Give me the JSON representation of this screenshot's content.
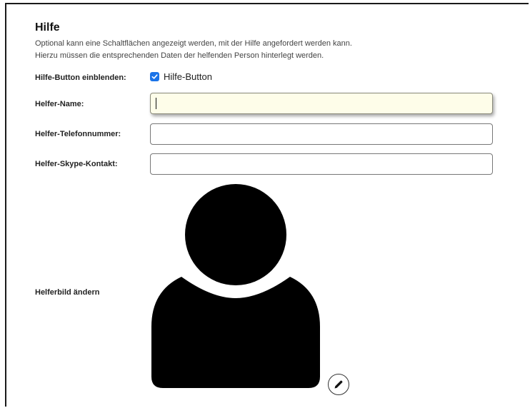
{
  "section": {
    "title": "Hilfe",
    "description_line1": "Optional kann eine Schaltflächen angezeigt werden, mit der Hilfe angefordert werden kann.",
    "description_line2": "Hierzu müssen die entsprechenden Daten der helfenden Person hinterlegt werden."
  },
  "form": {
    "help_button": {
      "label": "Hilfe-Button einblenden:",
      "checkbox_label": "Hilfe-Button",
      "checked": true
    },
    "helper_name": {
      "label": "Helfer-Name:",
      "value": ""
    },
    "helper_phone": {
      "label": "Helfer-Telefonnummer:",
      "value": ""
    },
    "helper_skype": {
      "label": "Helfer-Skype-Kontakt:",
      "value": ""
    },
    "helper_image": {
      "label": "Helferbild ändern",
      "icon": "person-silhouette-icon",
      "edit_icon": "pencil-icon"
    }
  },
  "colors": {
    "checkbox_accent": "#1a73e8",
    "focused_field_bg": "#fefde9"
  }
}
